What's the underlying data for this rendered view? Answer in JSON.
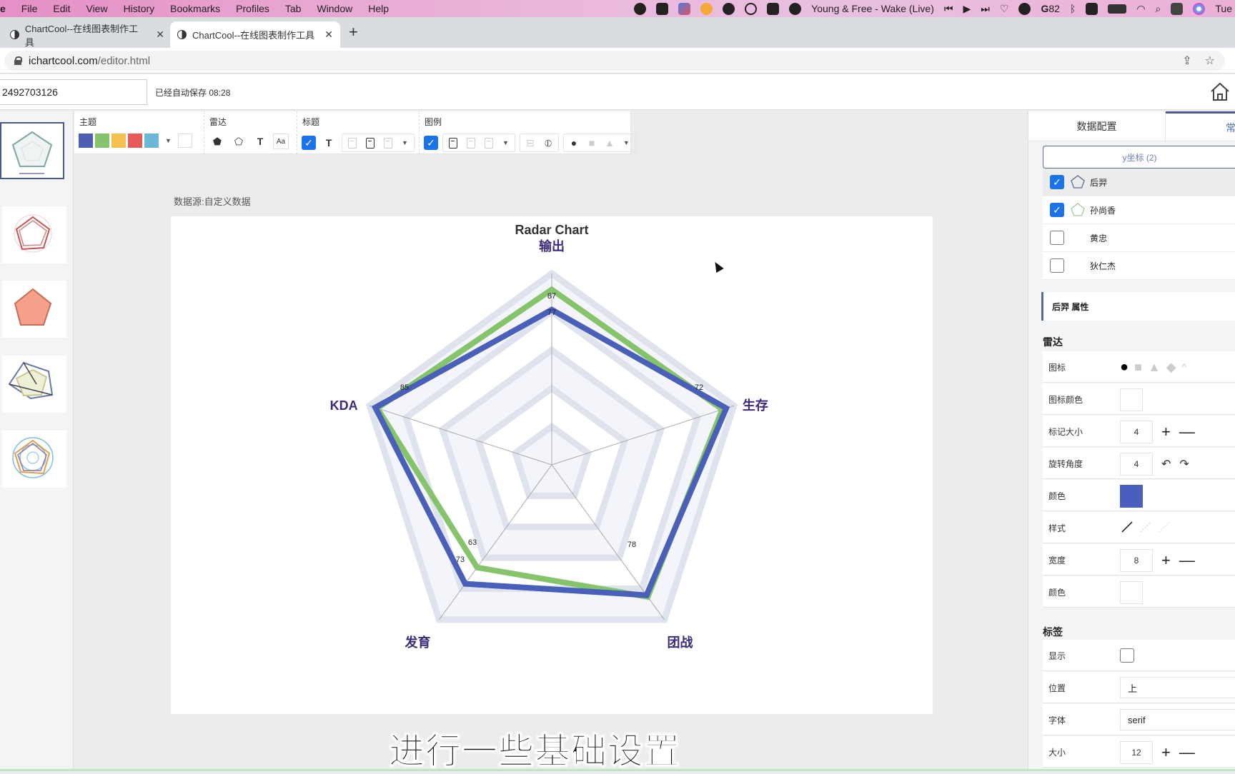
{
  "menubar": {
    "app_partial": "e",
    "items": [
      "File",
      "Edit",
      "View",
      "History",
      "Bookmarks",
      "Profiles",
      "Tab",
      "Window",
      "Help"
    ],
    "now_playing": "Young & Free - Wake (Live)",
    "badge_count": "82",
    "clock_partial": "Tue"
  },
  "browser": {
    "tabs": [
      {
        "title": "ChartCool--在线图表制作工具",
        "active": false
      },
      {
        "title": "ChartCool--在线图表制作工具",
        "active": true
      }
    ],
    "url_host": "ichartcool.com",
    "url_path": "/editor.html"
  },
  "header": {
    "doc_id": "2492703126",
    "autosave": "已经自动保存 08:28"
  },
  "toolbar": {
    "groups": [
      {
        "label": "主题"
      },
      {
        "label": "雷达"
      },
      {
        "label": "标题"
      },
      {
        "label": "图例"
      }
    ],
    "theme_colors": [
      "#4c5fb5",
      "#85c46c",
      "#f6c04e",
      "#e85a5a",
      "#6bb7d8"
    ],
    "title_checked": true,
    "legend_checked": true
  },
  "canvas": {
    "data_source": "数据源:自定义数据",
    "subtitle_caption": "进行一些基础设置"
  },
  "chart_data": {
    "type": "radar",
    "title": "Radar Chart",
    "indicators": [
      "输出",
      "生存",
      "团战",
      "发育",
      "KDA"
    ],
    "max": 95,
    "rings": 5,
    "series": [
      {
        "name": "后羿",
        "color": "#4a5fb8",
        "values": [
          77,
          91,
          80,
          73,
          92
        ]
      },
      {
        "name": "孙尚香",
        "color": "#86c46b",
        "values": [
          87,
          89,
          81,
          63,
          91
        ]
      }
    ],
    "data_labels": [
      {
        "axis": "输出",
        "text": "87"
      },
      {
        "axis": "输出",
        "text": "77"
      },
      {
        "axis": "生存",
        "text": "72"
      },
      {
        "axis": "团战",
        "text": "78"
      },
      {
        "axis": "发育",
        "text": "63"
      },
      {
        "axis": "发育",
        "text": "73"
      },
      {
        "axis": "KDA",
        "text": "85"
      }
    ]
  },
  "right_panel": {
    "tabs": [
      "数据配置",
      "常"
    ],
    "y_axis_button": "y坐标 (2)",
    "series_list": [
      {
        "name": "后羿",
        "checked": true,
        "icon_color": "#5a6a90",
        "selected": true
      },
      {
        "name": "孙尚香",
        "checked": true,
        "icon_color": "#a8c49a",
        "selected": false
      },
      {
        "name": "黄忠",
        "checked": false
      },
      {
        "name": "狄仁杰",
        "checked": false
      }
    ],
    "props_header": "后羿 属性",
    "radar_section": "雷达",
    "rows": {
      "icon_label": "图标",
      "icon_color_label": "图标颜色",
      "marker_size_label": "标记大小",
      "marker_size_value": "4",
      "rotation_label": "旋转角度",
      "rotation_value": "4",
      "color_label": "颜色",
      "color_value": "#4a5fbd",
      "style_label": "样式",
      "width_label": "宽度",
      "width_value": "8",
      "color2_label": "颜色"
    },
    "label_section": "标签",
    "label_rows": {
      "show_label": "显示",
      "show_checked": false,
      "position_label": "位置",
      "position_value": "上",
      "font_label": "字体",
      "font_value": "serif",
      "size_label": "大小",
      "size_value": "12"
    }
  }
}
